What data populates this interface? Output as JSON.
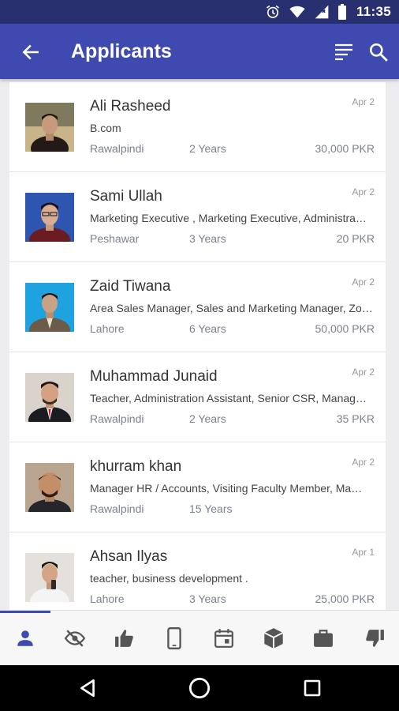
{
  "status_bar": {
    "time": "11:35"
  },
  "app_bar": {
    "title": "Applicants"
  },
  "applicants": [
    {
      "name": "Ali Rasheed",
      "date": "Apr 2",
      "title": "B.com",
      "city": "Rawalpindi",
      "experience": "2 Years",
      "salary": "30,000 PKR"
    },
    {
      "name": "Sami Ullah",
      "date": "Apr 2",
      "title": "Marketing Executive , Marketing Executive, Administra…",
      "city": "Peshawar",
      "experience": "3 Years",
      "salary": "20 PKR"
    },
    {
      "name": "Zaid Tiwana",
      "date": "Apr 2",
      "title": "Area Sales Manager, Sales and Marketing Manager, Zo…",
      "city": "Lahore",
      "experience": "6 Years",
      "salary": "50,000 PKR"
    },
    {
      "name": "Muhammad Junaid",
      "date": "Apr 2",
      "title": "Teacher, Administration Assistant, Senior CSR, Manag…",
      "city": "Rawalpindi",
      "experience": "2 Years",
      "salary": "35 PKR"
    },
    {
      "name": "khurram khan",
      "date": "Apr 2",
      "title": "Manager HR / Accounts, Visiting Faculty Member, Ma…",
      "city": "Rawalpindi",
      "experience": "15 Years",
      "salary": ""
    },
    {
      "name": "Ahsan Ilyas",
      "date": "Apr 1",
      "title": "teacher, business development .",
      "city": "Lahore",
      "experience": "3 Years",
      "salary": "25,000 PKR"
    }
  ],
  "bottom_nav": {
    "items": [
      "person-icon",
      "eye-off-icon",
      "thumb-up-icon",
      "phone-icon",
      "calendar-icon",
      "cube-icon",
      "briefcase-icon",
      "thumb-down-icon"
    ],
    "active_index": 0
  },
  "colors": {
    "status_bar": "#29306f",
    "app_bar": "#3f4ab1",
    "accent": "#3f4ab1",
    "muted_text": "#7b8190"
  }
}
